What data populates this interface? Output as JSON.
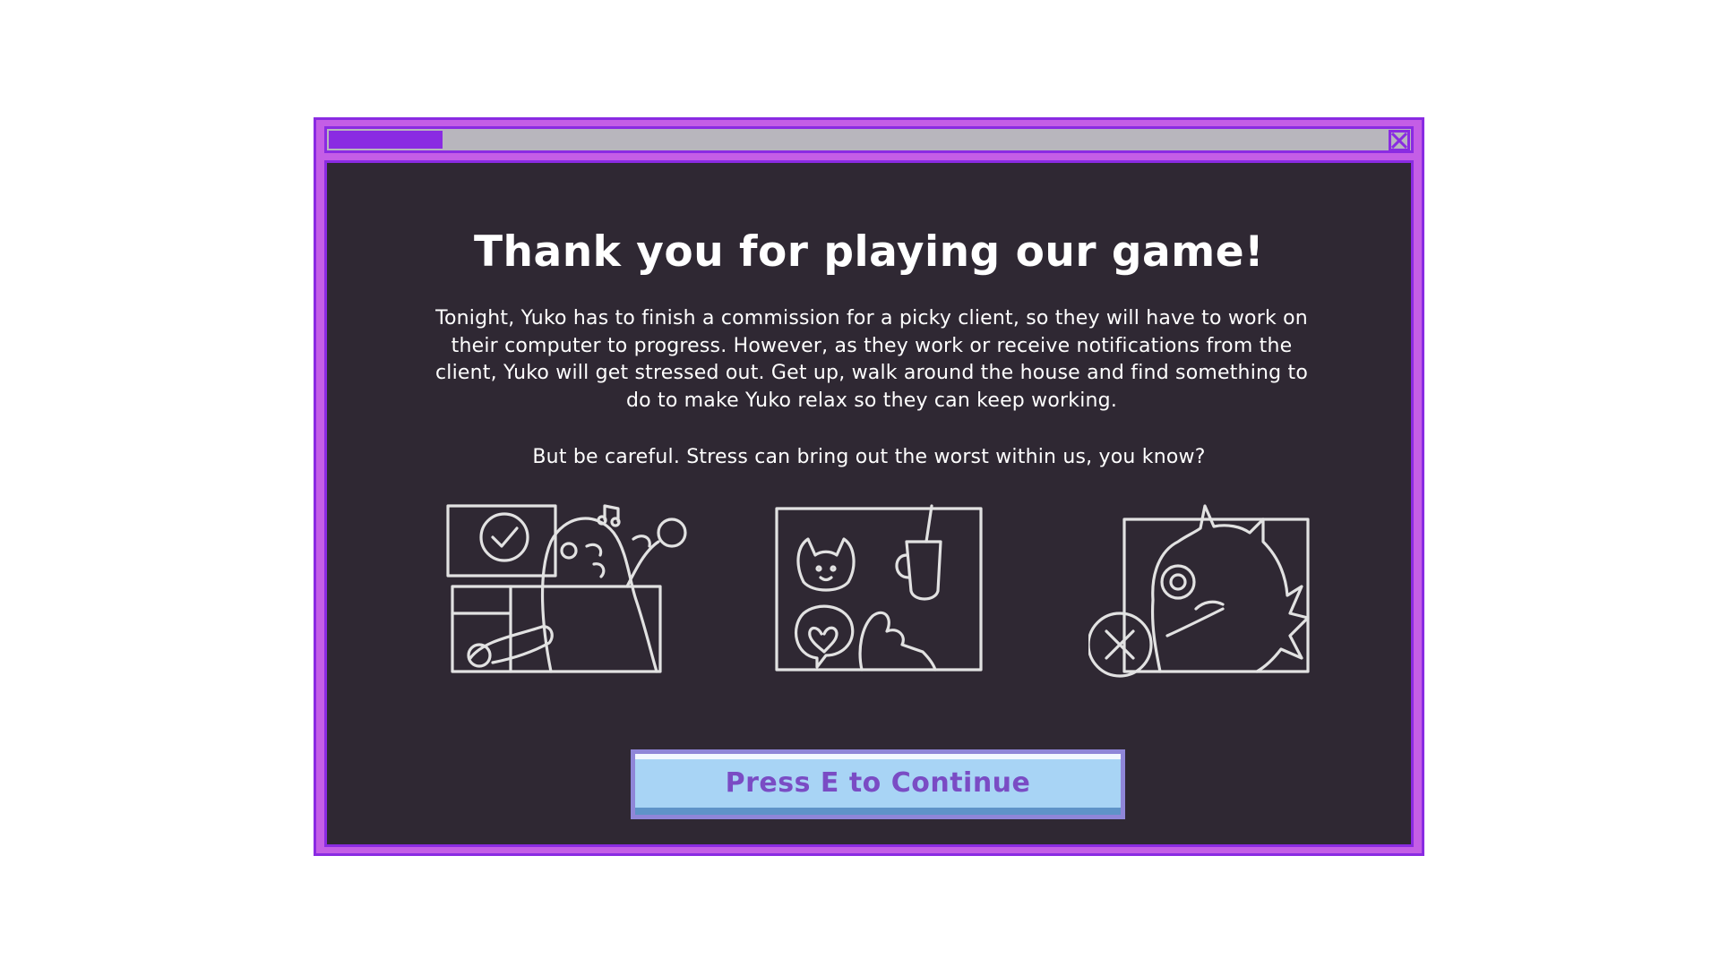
{
  "dialog": {
    "heading": "Thank you for playing our game!",
    "body": "Tonight, Yuko has to finish a commission for a picky client, so they will have to work on their computer to progress. However, as they work or receive notifications from the client, Yuko will get stressed out. Get up, walk around the house and find something to do to make Yuko relax so they can keep working.",
    "warning": "But be careful. Stress can bring out the worst within us, you know?",
    "continue_label": "Press E to Continue"
  },
  "icons": {
    "close": "close-icon",
    "illustration_1": "working-at-computer-icon",
    "illustration_2": "relax-activities-icon",
    "illustration_3": "stressed-out-icon"
  },
  "colors": {
    "accent": "#8a2be2",
    "frame": "#c45ee6",
    "panel": "#2f2833",
    "button": "#a8d4f5",
    "button_text": "#7a4cc4"
  }
}
